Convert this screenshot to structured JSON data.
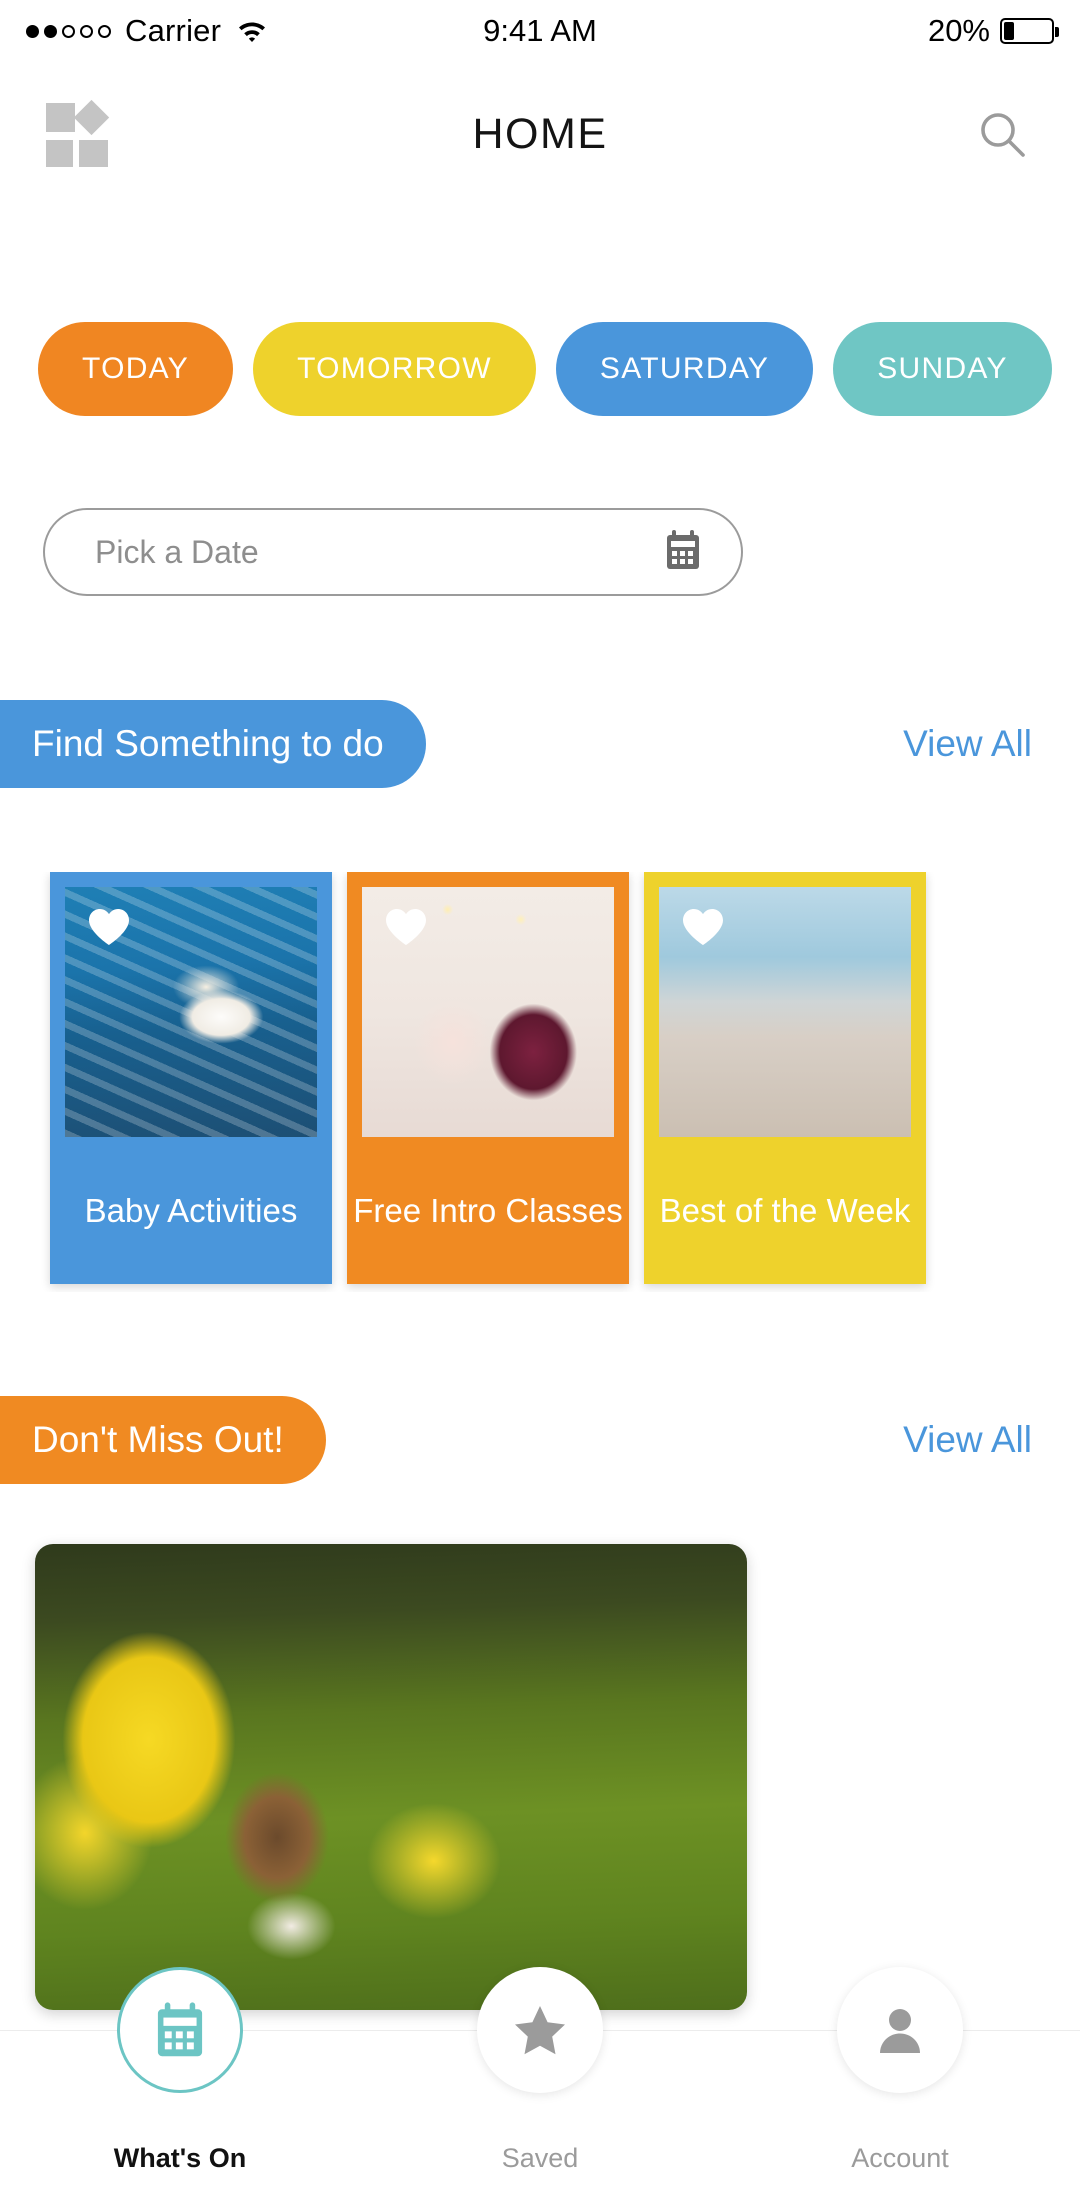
{
  "status_bar": {
    "signal_filled": 2,
    "signal_total": 5,
    "carrier": "Carrier",
    "wifi_icon": "wifi-icon",
    "time": "9:41 AM",
    "battery_percent": "20%",
    "battery_level": 20
  },
  "navbar": {
    "menu_icon": "grid-logo-icon",
    "title": "HOME",
    "search_icon": "search-icon"
  },
  "day_tabs": [
    {
      "label": "TODAY",
      "color": "#F08622"
    },
    {
      "label": "TOMORROW",
      "color": "#EED22C"
    },
    {
      "label": "SATURDAY",
      "color": "#4A96DB"
    },
    {
      "label": "SUNDAY",
      "color": "#6FC6C4"
    }
  ],
  "date_picker": {
    "placeholder": "Pick a Date",
    "value": "",
    "icon": "calendar-icon"
  },
  "sections": [
    {
      "title": "Find Something to do",
      "pill_color": "#4A96DB",
      "view_all": "View All"
    },
    {
      "title": "Don't Miss Out!",
      "pill_color": "#F08A22",
      "view_all": "View All"
    }
  ],
  "category_cards": [
    {
      "label": "Baby Activities",
      "color": "#4A96DB",
      "photo": "ph-baby",
      "favorite_icon": "heart-icon"
    },
    {
      "label": "Free Intro Classes",
      "color": "#F08A22",
      "photo": "ph-classes",
      "favorite_icon": "heart-icon"
    },
    {
      "label": "Best of the Week",
      "color": "#EED22C",
      "photo": "ph-best",
      "favorite_icon": "heart-icon"
    }
  ],
  "hero": {
    "photo": "hero-photo"
  },
  "tabbar": [
    {
      "label": "What's On",
      "icon": "calendar-icon",
      "active": true
    },
    {
      "label": "Saved",
      "icon": "star-icon",
      "active": false
    },
    {
      "label": "Account",
      "icon": "person-icon",
      "active": false
    }
  ]
}
